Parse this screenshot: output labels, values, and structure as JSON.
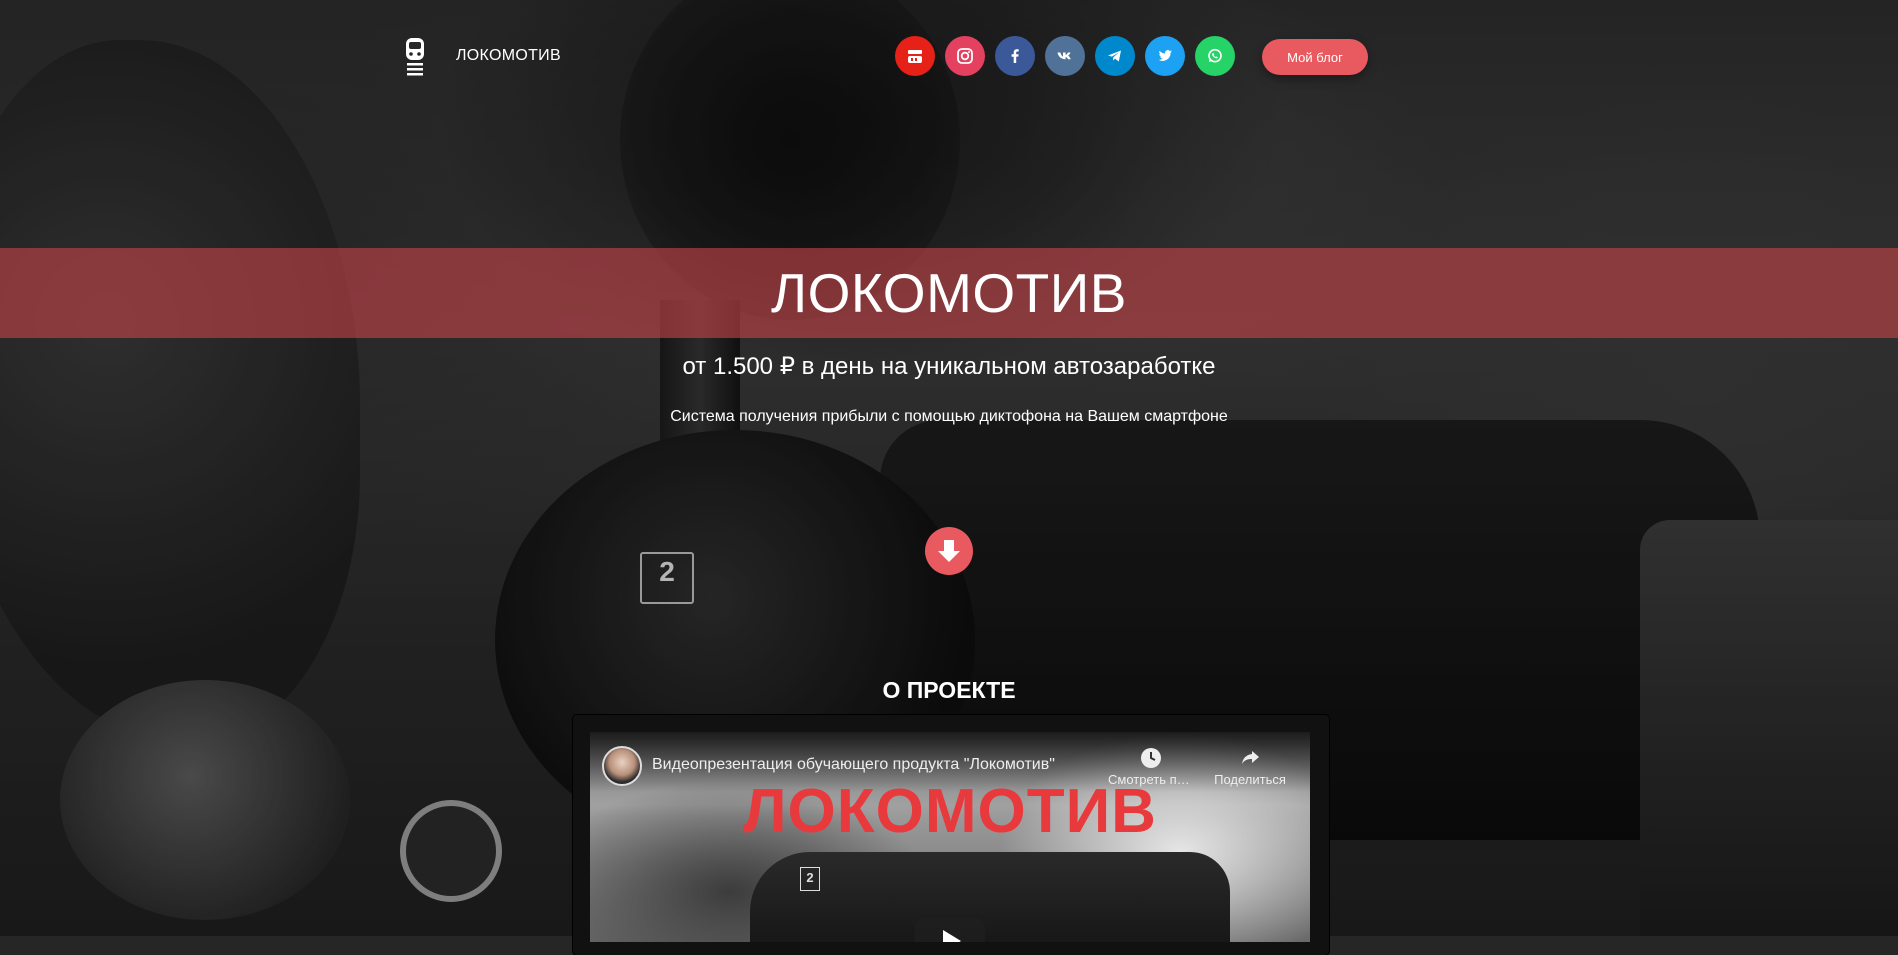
{
  "header": {
    "brand_label": "ЛОКОМОТИВ",
    "socials": [
      {
        "name": "youtube",
        "color": "#e62117"
      },
      {
        "name": "instagram",
        "color": "#e4405f"
      },
      {
        "name": "facebook",
        "color": "#3b5998"
      },
      {
        "name": "vk",
        "color": "#507299"
      },
      {
        "name": "telegram",
        "color": "#0088cc"
      },
      {
        "name": "twitter",
        "color": "#1da1f2"
      },
      {
        "name": "whatsapp",
        "color": "#25d366"
      }
    ],
    "blog_button": "Мой блог"
  },
  "hero": {
    "title": "ЛОКОМОТИВ",
    "subtitle": "от 1.500 ₽ в день на уникальном автозаработке",
    "description": "Система получения прибыли с помощью диктофона на Вашем смартфоне",
    "accent_color": "#e85a5f"
  },
  "about": {
    "section_title": "О ПРОЕКТЕ",
    "video": {
      "caption": "Видеопрезентация обучающего продукта \"Локомотив\"",
      "watch_later": "Смотреть позже",
      "share": "Поделиться",
      "overlay_title": "ЛОКОМОТИВ",
      "plate_number": "2"
    }
  },
  "background": {
    "plate_number": "2"
  }
}
